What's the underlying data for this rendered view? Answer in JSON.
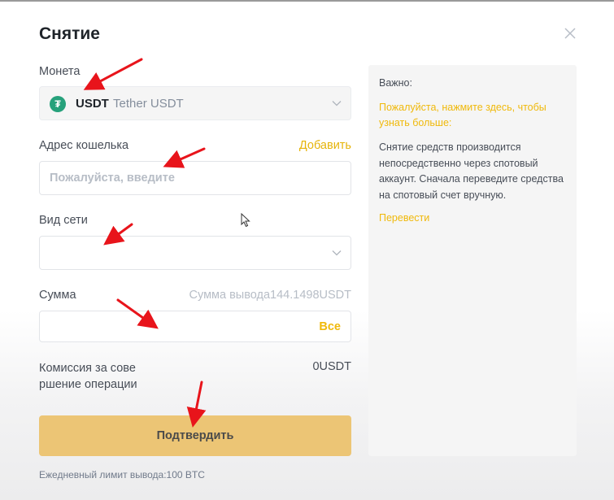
{
  "dialog": {
    "title": "Снятие"
  },
  "coin": {
    "label": "Монета",
    "symbol": "USDT",
    "name": "Tether USDT",
    "logo_letter": "₮",
    "logo_color": "#26A17B"
  },
  "address": {
    "label": "Адрес кошелька",
    "add_label": "Добавить",
    "placeholder": "Пожалуйста, введите",
    "value": ""
  },
  "network": {
    "label": "Вид сети",
    "selected": ""
  },
  "amount": {
    "label": "Сумма",
    "available": "Сумма вывода144.1498USDT",
    "value": "",
    "max_label": "Все"
  },
  "fee": {
    "label": "Комиссия за сове ршение операции",
    "value": "0USDT"
  },
  "confirm_label": "Подтвердить",
  "daily_limit": "Ежедневный лимит вывода:100 BTC",
  "info": {
    "title": "Важно:",
    "link": "Пожалуйста, нажмите здесь, чтобы узнать больше:",
    "text": "Снятие средств производится непосредственно через спотовый аккаунт. Сначала переведите средства на спотовый счет вручную.",
    "transfer_label": "Перевести"
  },
  "colors": {
    "accent": "#F0B90B",
    "confirm_button": "#ECC575",
    "annotation_arrow": "#E8141B",
    "info_panel": "#F5F5F5"
  },
  "icons": [
    "close-icon",
    "tether-logo-icon",
    "chevron-down-icon",
    "mouse-cursor-icon",
    "red-arrow-annotation"
  ]
}
